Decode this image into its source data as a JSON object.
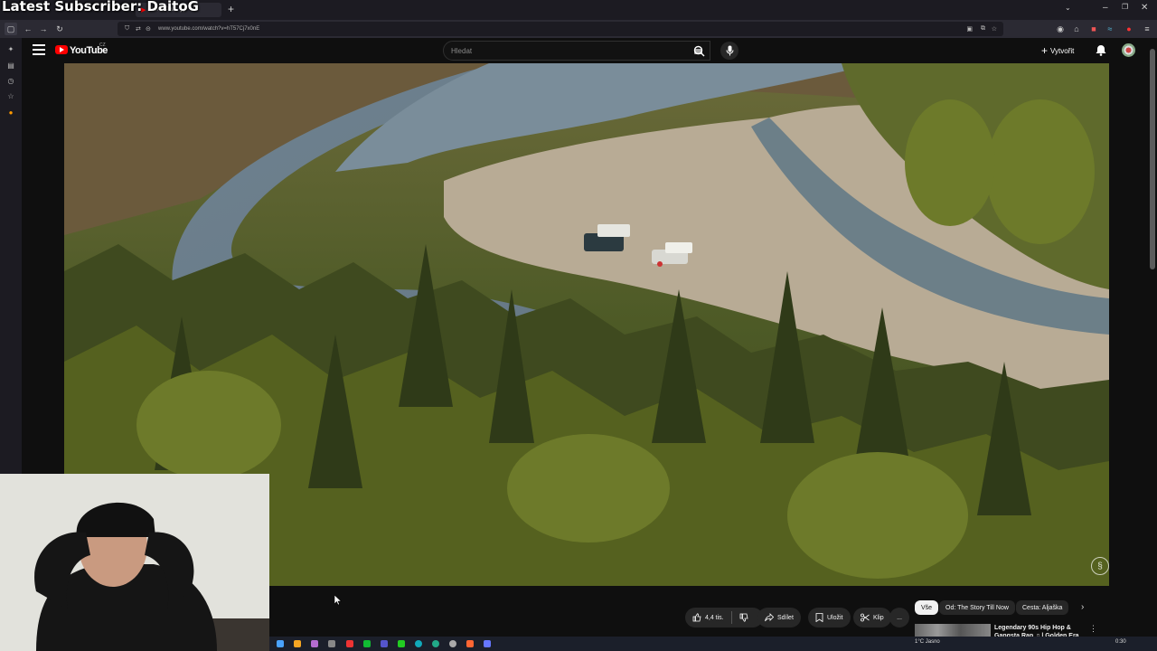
{
  "overlay": {
    "latest_subscriber": "Latest Subscriber: DaitoG"
  },
  "browser": {
    "tab_active_label": "SWAMP &",
    "url": "www.youtube.com/watch?v=hT57Cj7x0nE"
  },
  "youtube": {
    "logo_text": "YouTube",
    "country_code": "CZ",
    "search_placeholder": "Hledat",
    "create_label": "Vytvořit"
  },
  "video": {
    "description": "aerial view of river and forest"
  },
  "actions": {
    "like_count": "4,4 tis.",
    "share_label": "Sdílet",
    "save_label": "Uložit",
    "clip_label": "Klip",
    "more_label": "..."
  },
  "chips": [
    "Vše",
    "Od: The Story Till Now",
    "Cesta: Aljaška"
  ],
  "recommendation": {
    "title": "Legendary 90s Hip Hop & Gangsta Rap ♫ | Golden Era"
  },
  "taskbar": {
    "weather": "1°C Jasno",
    "clock": "0:30"
  },
  "colors": {
    "youtube_red": "#ff0000",
    "page_bg": "#0f0f0f",
    "chip_active_bg": "#f1f1f1"
  },
  "icons": [
    "menu-icon",
    "search-icon",
    "mic-icon",
    "bell-icon",
    "like-icon",
    "dislike-icon",
    "share-icon",
    "bookmark-icon",
    "scissors-icon",
    "chevron-right-icon"
  ]
}
